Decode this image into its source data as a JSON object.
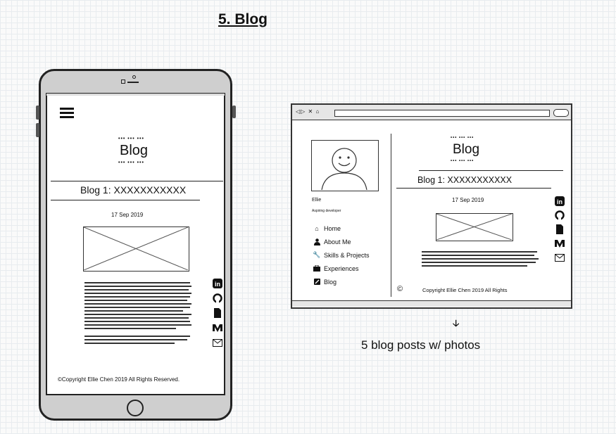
{
  "page_title": "5. Blog",
  "tablet": {
    "heading": "Blog",
    "dots": "••• ••• •••",
    "post_title": "Blog 1: XXXXXXXXXXX",
    "date": "17 Sep 2019",
    "footer": "©Copyright Ellie Chen 2019 All Rights Reserved."
  },
  "browser": {
    "heading": "Blog",
    "dots": "••• ••• •••",
    "profile_name": "Ellie",
    "profile_tagline": "Aspiring developer",
    "nav": [
      {
        "label": "Home",
        "icon": "home-icon"
      },
      {
        "label": "About Me",
        "icon": "user-icon"
      },
      {
        "label": "Skills & Projects",
        "icon": "wrench-icon"
      },
      {
        "label": "Experiences",
        "icon": "briefcase-icon"
      },
      {
        "label": "Blog",
        "icon": "edit-icon"
      }
    ],
    "post_title": "Blog 1: XXXXXXXXXXX",
    "date": "17 Sep 2019",
    "copyright_symbol": "©",
    "footer": "Copyright Ellie Chen 2019 All Rights"
  },
  "social_icons": [
    "linkedin-icon",
    "github-icon",
    "file-icon",
    "medium-icon",
    "mail-icon"
  ],
  "annotation": {
    "arrow": "🡣",
    "text": "5 blog posts w/ photos"
  }
}
